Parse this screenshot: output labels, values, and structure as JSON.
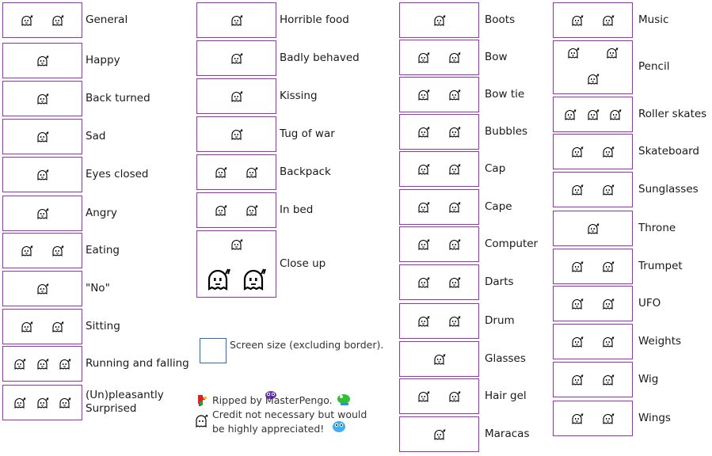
{
  "colors": {
    "box_border": "#9b2fc0",
    "legend_border": "#2a6bc0",
    "text": "#1a1a1a"
  },
  "columns": [
    {
      "items": [
        {
          "label": "General",
          "sprites": 2
        },
        {
          "label": "Happy",
          "sprites": 1
        },
        {
          "label": "Back turned",
          "sprites": 1
        },
        {
          "label": "Sad",
          "sprites": 1
        },
        {
          "label": "Eyes closed",
          "sprites": 1
        },
        {
          "label": "Angry",
          "sprites": 1
        },
        {
          "label": "Eating",
          "sprites": 2
        },
        {
          "label": "\"No\"",
          "sprites": 1
        },
        {
          "label": "Sitting",
          "sprites": 2
        },
        {
          "label": "Running and falling",
          "sprites": 3
        },
        {
          "label": "(Un)pleasantly",
          "label2": "Surprised",
          "sprites": 3
        }
      ]
    },
    {
      "items": [
        {
          "label": "Horrible food",
          "sprites": 1
        },
        {
          "label": "Badly behaved",
          "sprites": 1
        },
        {
          "label": "Kissing",
          "sprites": 1
        },
        {
          "label": "Tug of war",
          "sprites": 1
        },
        {
          "label": "Backpack",
          "sprites": 2
        },
        {
          "label": "In bed",
          "sprites": 2
        },
        {
          "label": "Close up",
          "sprites": 3
        }
      ]
    },
    {
      "items": [
        {
          "label": "Boots",
          "sprites": 1
        },
        {
          "label": "Bow",
          "sprites": 2
        },
        {
          "label": "Bow tie",
          "sprites": 2
        },
        {
          "label": "Bubbles",
          "sprites": 2
        },
        {
          "label": "Cap",
          "sprites": 2
        },
        {
          "label": "Cape",
          "sprites": 2
        },
        {
          "label": "Computer",
          "sprites": 2
        },
        {
          "label": "Darts",
          "sprites": 2
        },
        {
          "label": "Drum",
          "sprites": 2
        },
        {
          "label": "Glasses",
          "sprites": 1
        },
        {
          "label": "Hair gel",
          "sprites": 2
        },
        {
          "label": "Maracas",
          "sprites": 1
        }
      ]
    },
    {
      "items": [
        {
          "label": "Music",
          "sprites": 2
        },
        {
          "label": "Pencil",
          "sprites": 3
        },
        {
          "label": "Roller skates",
          "sprites": 3
        },
        {
          "label": "Skateboard",
          "sprites": 2
        },
        {
          "label": "Sunglasses",
          "sprites": 2
        },
        {
          "label": "Throne",
          "sprites": 1
        },
        {
          "label": "Trumpet",
          "sprites": 2
        },
        {
          "label": "UFO",
          "sprites": 2
        },
        {
          "label": "Weights",
          "sprites": 2
        },
        {
          "label": "Wig",
          "sprites": 2
        },
        {
          "label": "Wings",
          "sprites": 2
        }
      ]
    }
  ],
  "legend": {
    "text": "Screen size (excluding border)."
  },
  "credits": {
    "line1": "Ripped by MasterPengo.",
    "line2": "Credit not necessary but would",
    "line3": "be highly appreciated!"
  }
}
